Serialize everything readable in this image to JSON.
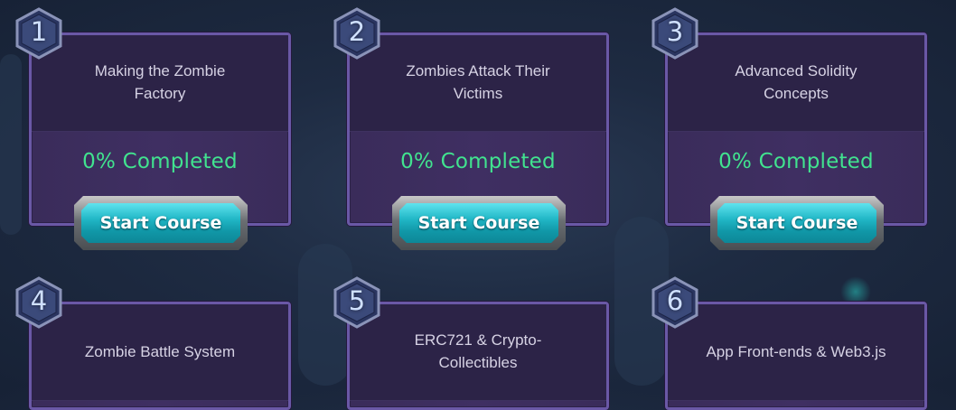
{
  "courses": [
    {
      "number": "1",
      "title": "Making the Zombie Factory",
      "progress": "0% Completed",
      "button_label": "Start Course"
    },
    {
      "number": "2",
      "title": "Zombies Attack Their Victims",
      "progress": "0% Completed",
      "button_label": "Start Course"
    },
    {
      "number": "3",
      "title": "Advanced Solidity Concepts",
      "progress": "0% Completed",
      "button_label": "Start Course"
    },
    {
      "number": "4",
      "title": "Zombie Battle System"
    },
    {
      "number": "5",
      "title": "ERC721 & Crypto-\nCollectibles"
    },
    {
      "number": "6",
      "title": "App Front-ends & Web3.js"
    }
  ],
  "colors": {
    "card_border": "#6a58a6",
    "progress_text": "#41e38f",
    "button_teal": "#21b7c6",
    "badge_fill": "#3b4a7a"
  }
}
